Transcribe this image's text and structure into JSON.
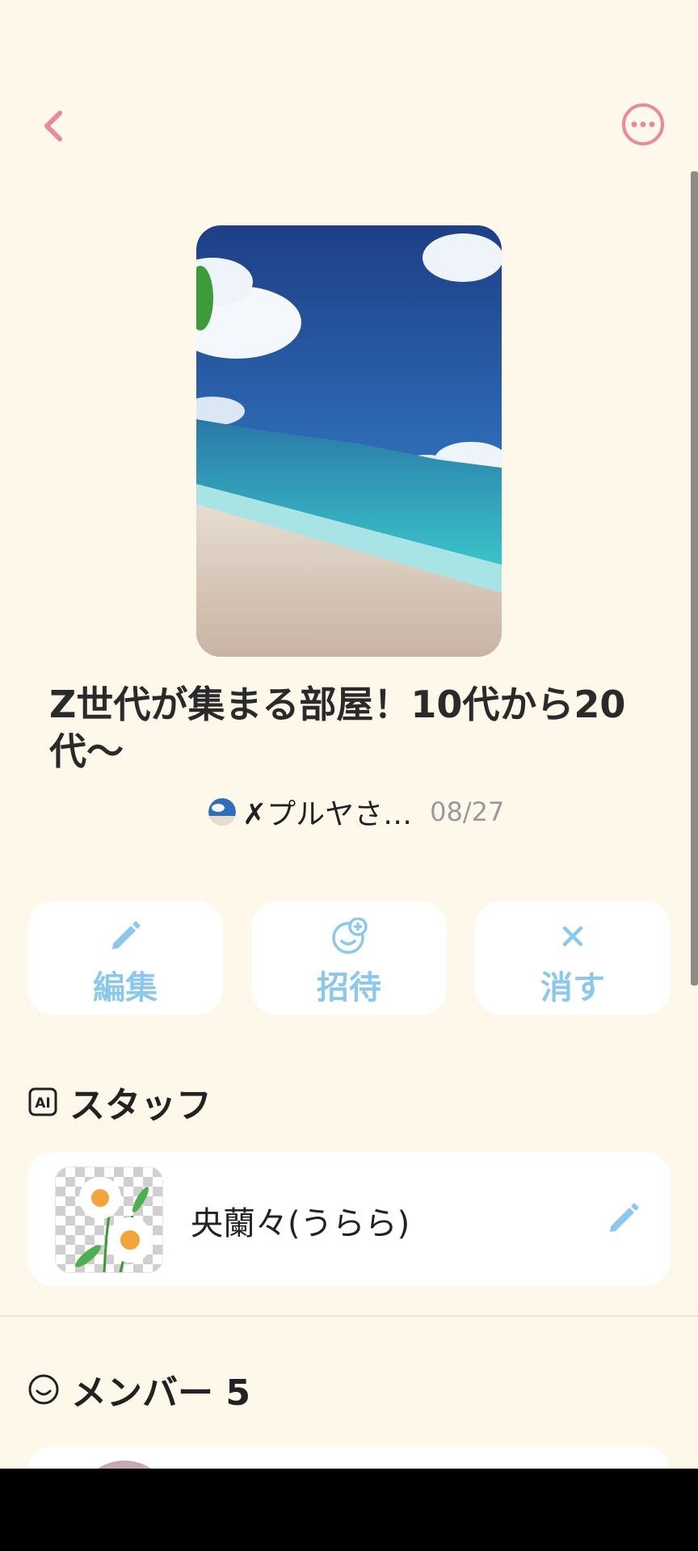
{
  "header": {
    "back_icon": "chevron-left-icon",
    "more_icon": "more-circle-icon",
    "accent": "#e98a9a"
  },
  "room": {
    "title": "Z世代が集まる部屋！10代から20代〜",
    "owner_name": "✗プルヤさ…",
    "date": "08/27"
  },
  "actions": [
    {
      "label": "編集",
      "icon": "pencil-icon"
    },
    {
      "label": "招待",
      "icon": "add-person-icon"
    },
    {
      "label": "消す",
      "icon": "close-icon"
    }
  ],
  "action_color": "#8cc8ec",
  "staff": {
    "heading": "スタッフ",
    "heading_icon": "ai-icon",
    "member": {
      "name": "央蘭々(うらら)",
      "edit_icon": "pencil-icon"
    }
  },
  "members": {
    "heading": "メンバー 5",
    "heading_icon": "smiley-icon"
  }
}
